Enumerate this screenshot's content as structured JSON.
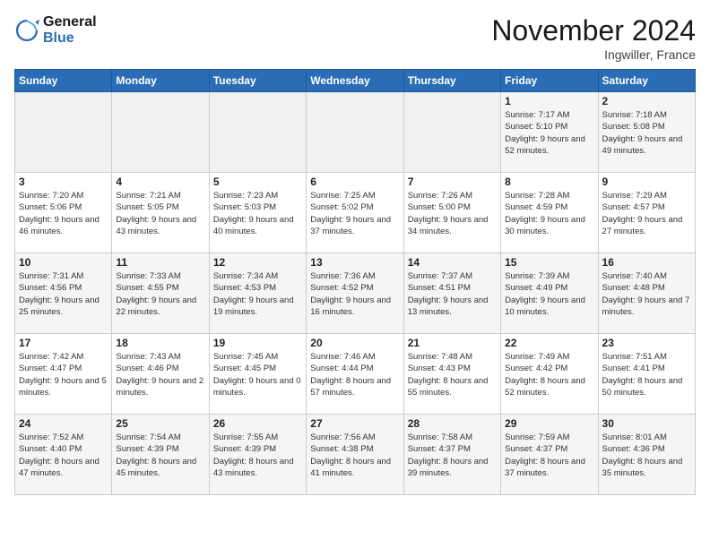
{
  "logo": {
    "line1": "General",
    "line2": "Blue"
  },
  "title": "November 2024",
  "location": "Ingwiller, France",
  "weekdays": [
    "Sunday",
    "Monday",
    "Tuesday",
    "Wednesday",
    "Thursday",
    "Friday",
    "Saturday"
  ],
  "rows": [
    [
      {
        "day": "",
        "info": ""
      },
      {
        "day": "",
        "info": ""
      },
      {
        "day": "",
        "info": ""
      },
      {
        "day": "",
        "info": ""
      },
      {
        "day": "",
        "info": ""
      },
      {
        "day": "1",
        "info": "Sunrise: 7:17 AM\nSunset: 5:10 PM\nDaylight: 9 hours and 52 minutes."
      },
      {
        "day": "2",
        "info": "Sunrise: 7:18 AM\nSunset: 5:08 PM\nDaylight: 9 hours and 49 minutes."
      }
    ],
    [
      {
        "day": "3",
        "info": "Sunrise: 7:20 AM\nSunset: 5:06 PM\nDaylight: 9 hours and 46 minutes."
      },
      {
        "day": "4",
        "info": "Sunrise: 7:21 AM\nSunset: 5:05 PM\nDaylight: 9 hours and 43 minutes."
      },
      {
        "day": "5",
        "info": "Sunrise: 7:23 AM\nSunset: 5:03 PM\nDaylight: 9 hours and 40 minutes."
      },
      {
        "day": "6",
        "info": "Sunrise: 7:25 AM\nSunset: 5:02 PM\nDaylight: 9 hours and 37 minutes."
      },
      {
        "day": "7",
        "info": "Sunrise: 7:26 AM\nSunset: 5:00 PM\nDaylight: 9 hours and 34 minutes."
      },
      {
        "day": "8",
        "info": "Sunrise: 7:28 AM\nSunset: 4:59 PM\nDaylight: 9 hours and 30 minutes."
      },
      {
        "day": "9",
        "info": "Sunrise: 7:29 AM\nSunset: 4:57 PM\nDaylight: 9 hours and 27 minutes."
      }
    ],
    [
      {
        "day": "10",
        "info": "Sunrise: 7:31 AM\nSunset: 4:56 PM\nDaylight: 9 hours and 25 minutes."
      },
      {
        "day": "11",
        "info": "Sunrise: 7:33 AM\nSunset: 4:55 PM\nDaylight: 9 hours and 22 minutes."
      },
      {
        "day": "12",
        "info": "Sunrise: 7:34 AM\nSunset: 4:53 PM\nDaylight: 9 hours and 19 minutes."
      },
      {
        "day": "13",
        "info": "Sunrise: 7:36 AM\nSunset: 4:52 PM\nDaylight: 9 hours and 16 minutes."
      },
      {
        "day": "14",
        "info": "Sunrise: 7:37 AM\nSunset: 4:51 PM\nDaylight: 9 hours and 13 minutes."
      },
      {
        "day": "15",
        "info": "Sunrise: 7:39 AM\nSunset: 4:49 PM\nDaylight: 9 hours and 10 minutes."
      },
      {
        "day": "16",
        "info": "Sunrise: 7:40 AM\nSunset: 4:48 PM\nDaylight: 9 hours and 7 minutes."
      }
    ],
    [
      {
        "day": "17",
        "info": "Sunrise: 7:42 AM\nSunset: 4:47 PM\nDaylight: 9 hours and 5 minutes."
      },
      {
        "day": "18",
        "info": "Sunrise: 7:43 AM\nSunset: 4:46 PM\nDaylight: 9 hours and 2 minutes."
      },
      {
        "day": "19",
        "info": "Sunrise: 7:45 AM\nSunset: 4:45 PM\nDaylight: 9 hours and 0 minutes."
      },
      {
        "day": "20",
        "info": "Sunrise: 7:46 AM\nSunset: 4:44 PM\nDaylight: 8 hours and 57 minutes."
      },
      {
        "day": "21",
        "info": "Sunrise: 7:48 AM\nSunset: 4:43 PM\nDaylight: 8 hours and 55 minutes."
      },
      {
        "day": "22",
        "info": "Sunrise: 7:49 AM\nSunset: 4:42 PM\nDaylight: 8 hours and 52 minutes."
      },
      {
        "day": "23",
        "info": "Sunrise: 7:51 AM\nSunset: 4:41 PM\nDaylight: 8 hours and 50 minutes."
      }
    ],
    [
      {
        "day": "24",
        "info": "Sunrise: 7:52 AM\nSunset: 4:40 PM\nDaylight: 8 hours and 47 minutes."
      },
      {
        "day": "25",
        "info": "Sunrise: 7:54 AM\nSunset: 4:39 PM\nDaylight: 8 hours and 45 minutes."
      },
      {
        "day": "26",
        "info": "Sunrise: 7:55 AM\nSunset: 4:39 PM\nDaylight: 8 hours and 43 minutes."
      },
      {
        "day": "27",
        "info": "Sunrise: 7:56 AM\nSunset: 4:38 PM\nDaylight: 8 hours and 41 minutes."
      },
      {
        "day": "28",
        "info": "Sunrise: 7:58 AM\nSunset: 4:37 PM\nDaylight: 8 hours and 39 minutes."
      },
      {
        "day": "29",
        "info": "Sunrise: 7:59 AM\nSunset: 4:37 PM\nDaylight: 8 hours and 37 minutes."
      },
      {
        "day": "30",
        "info": "Sunrise: 8:01 AM\nSunset: 4:36 PM\nDaylight: 8 hours and 35 minutes."
      }
    ]
  ]
}
